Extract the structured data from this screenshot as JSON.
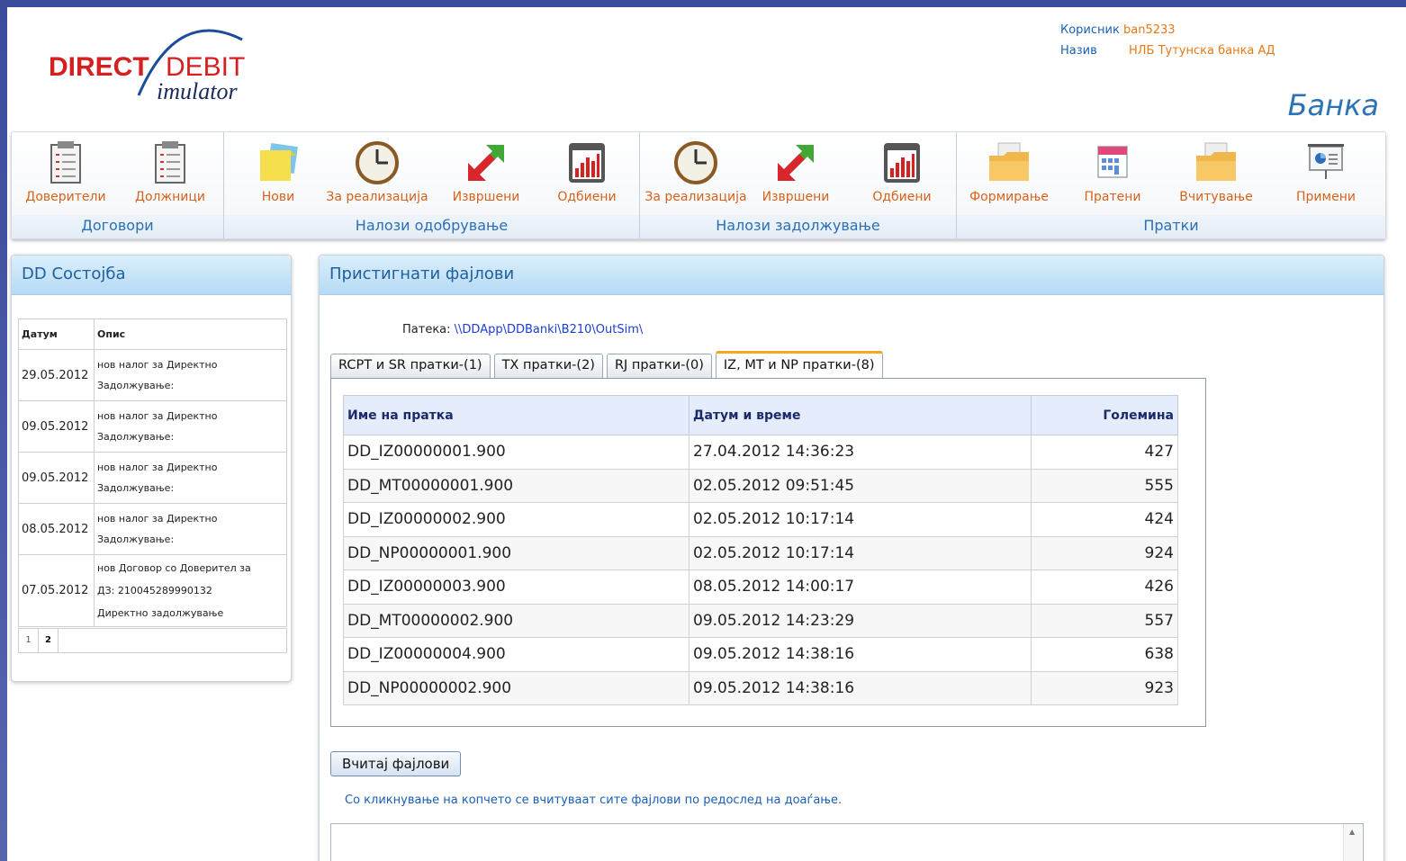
{
  "header": {
    "logo_word1": "DIRECT",
    "logo_word2": "DEBIT",
    "logo_word3": "imulator",
    "user_label": "Корисник",
    "user_value": "ban5233",
    "name_label": "Назив",
    "name_value": "НЛБ Тутунска банка АД",
    "role": "Банка"
  },
  "toolbar": {
    "groups": [
      {
        "label": "Договори",
        "items": [
          {
            "label": "Доверители",
            "icon": "clipboard-list-icon"
          },
          {
            "label": "Должници",
            "icon": "clipboard-list-icon"
          }
        ]
      },
      {
        "label": "Налози одобрување",
        "items": [
          {
            "label": "Нови",
            "icon": "sticky-notes-icon"
          },
          {
            "label": "За реализација",
            "icon": "clock-icon"
          },
          {
            "label": "Извршени",
            "icon": "arrows-icon"
          },
          {
            "label": "Одбиени",
            "icon": "bar-chart-icon"
          }
        ]
      },
      {
        "label": "Налози задолжување",
        "items": [
          {
            "label": "За реализација",
            "icon": "clock-icon"
          },
          {
            "label": "Извршени",
            "icon": "arrows-icon"
          },
          {
            "label": "Одбиени",
            "icon": "bar-chart-icon"
          }
        ]
      },
      {
        "label": "Пратки",
        "items": [
          {
            "label": "Формирање",
            "icon": "folder-icon"
          },
          {
            "label": "Пратени",
            "icon": "calendar-icon"
          },
          {
            "label": "Вчитување",
            "icon": "folder-icon"
          },
          {
            "label": "Примени",
            "icon": "presentation-icon"
          }
        ]
      }
    ]
  },
  "status_panel": {
    "title": "DD Состојба",
    "columns": [
      "Датум",
      "Опис"
    ],
    "rows": [
      {
        "date": "29.05.2012",
        "desc1": "нов налог за Директно",
        "desc2": "Задолжување:"
      },
      {
        "date": "09.05.2012",
        "desc1": "нов налог за Директно",
        "desc2": "Задолжување:"
      },
      {
        "date": "09.05.2012",
        "desc1": "нов налог за Директно",
        "desc2": "Задолжување:"
      },
      {
        "date": "08.05.2012",
        "desc1": "нов налог за Директно",
        "desc2": "Задолжување:"
      },
      {
        "date": "07.05.2012",
        "desc1": "нов Договор со Доверител за",
        "desc2": "ДЗ: 210045289990132",
        "desc3": "Директно задолжување"
      }
    ],
    "pages": [
      "1",
      "2"
    ]
  },
  "main": {
    "title": "Пристигнати фајлови",
    "path_label": "Патека:",
    "path_value": "\\\\DDApp\\DDBanki\\B210\\OutSim\\",
    "tabs": [
      "RCPT и SR пратки-(1)",
      "TX пратки-(2)",
      "RJ пратки-(0)",
      "IZ, MT и NP пратки-(8)"
    ],
    "active_tab": 3,
    "table": {
      "columns": [
        "Име на пратка",
        "Датум и време",
        "Големина"
      ],
      "rows": [
        [
          "DD_IZ00000001.900",
          "27.04.2012 14:36:23",
          "427"
        ],
        [
          "DD_MT00000001.900",
          "02.05.2012 09:51:45",
          "555"
        ],
        [
          "DD_IZ00000002.900",
          "02.05.2012 10:17:14",
          "424"
        ],
        [
          "DD_NP00000001.900",
          "02.05.2012 10:17:14",
          "924"
        ],
        [
          "DD_IZ00000003.900",
          "08.05.2012 14:00:17",
          "426"
        ],
        [
          "DD_MT00000002.900",
          "09.05.2012 14:23:29",
          "557"
        ],
        [
          "DD_IZ00000004.900",
          "09.05.2012 14:38:16",
          "638"
        ],
        [
          "DD_NP00000002.900",
          "09.05.2012 14:38:16",
          "923"
        ]
      ]
    },
    "load_button": "Вчитај фајлови",
    "hint": "Со кликнување на копчето се вчитуваат сите фајлови по редослед на доаѓање."
  }
}
